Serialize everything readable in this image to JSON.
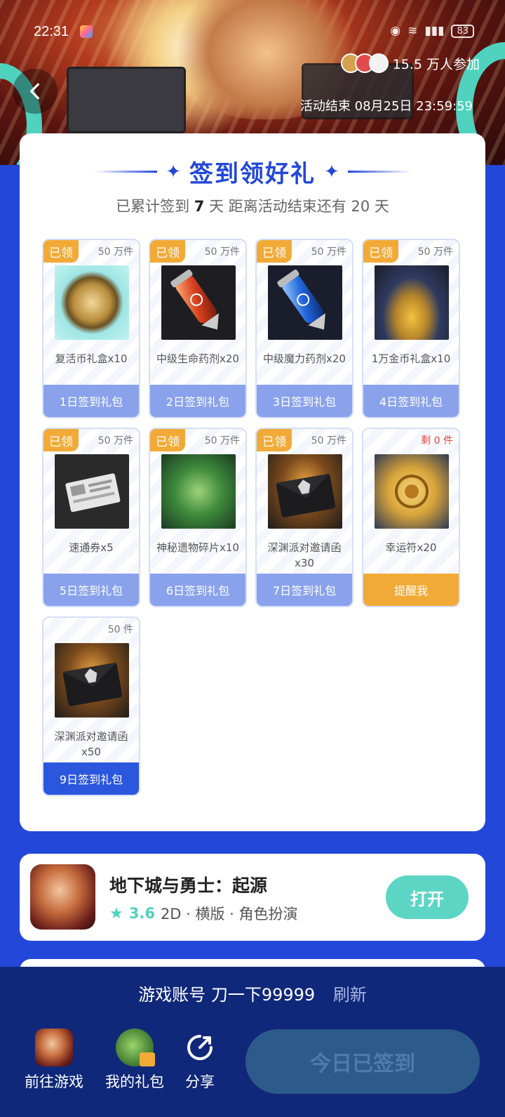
{
  "status_bar": {
    "time": "22:31",
    "battery": "83"
  },
  "hero": {
    "participants": "15.5 万人参加",
    "end_time": "活动结束 08月25日 23:59:59"
  },
  "checkin": {
    "title": "签到领好礼",
    "subtitle_prefix": "已累计签到",
    "days_signed": "7",
    "subtitle_mid": "天  距离活动结束还有",
    "days_left": "20",
    "subtitle_suffix": "天"
  },
  "gifts": [
    {
      "tag": "已领",
      "qty": "50 万件",
      "name": "复活币礼盒x10",
      "footer": "1日签到礼包",
      "icon": "revive-coin-icon"
    },
    {
      "tag": "已领",
      "qty": "50 万件",
      "name": "中级生命药剂x20",
      "footer": "2日签到礼包",
      "icon": "red-potion-icon"
    },
    {
      "tag": "已领",
      "qty": "50 万件",
      "name": "中级魔力药剂x20",
      "footer": "3日签到礼包",
      "icon": "blue-potion-icon"
    },
    {
      "tag": "已领",
      "qty": "50 万件",
      "name": "1万金币礼盒x10",
      "footer": "4日签到礼包",
      "icon": "treasure-chest-icon"
    },
    {
      "tag": "已领",
      "qty": "50 万件",
      "name": "速通券x5",
      "footer": "5日签到礼包",
      "icon": "ticket-icon"
    },
    {
      "tag": "已领",
      "qty": "50 万件",
      "name": "神秘遗物碎片x10",
      "footer": "6日签到礼包",
      "icon": "relic-fragment-icon"
    },
    {
      "tag": "已领",
      "qty": "50 万件",
      "name": "深渊派对邀请函x30",
      "footer": "7日签到礼包",
      "icon": "abyss-envelope-icon"
    },
    {
      "tag": "",
      "qty": "剩 0 件",
      "name": "幸运符x20",
      "footer": "提醒我",
      "icon": "lucky-charm-icon"
    },
    {
      "tag": "",
      "qty": "50 件",
      "name": "深渊派对邀请函x50",
      "footer": "9日签到礼包",
      "icon": "abyss-envelope-icon"
    }
  ],
  "game": {
    "name": "地下城与勇士：起源",
    "rating": "3.6",
    "tags": "2D · 横版 · 角色扮演",
    "open_label": "打开"
  },
  "bottom": {
    "account_label": "游戏账号 刀一下99999",
    "refresh_label": "刷新",
    "nav": [
      {
        "label": "前往游戏",
        "icon": "game-icon"
      },
      {
        "label": "我的礼包",
        "icon": "gift-icon"
      },
      {
        "label": "分享",
        "icon": "share-icon"
      }
    ],
    "checkin_label": "今日已签到"
  },
  "colors": {
    "primary": "#2347d9",
    "accent_orange": "#f2aa37",
    "teal": "#5dd5c4",
    "footer_light": "#8aa2ec"
  }
}
